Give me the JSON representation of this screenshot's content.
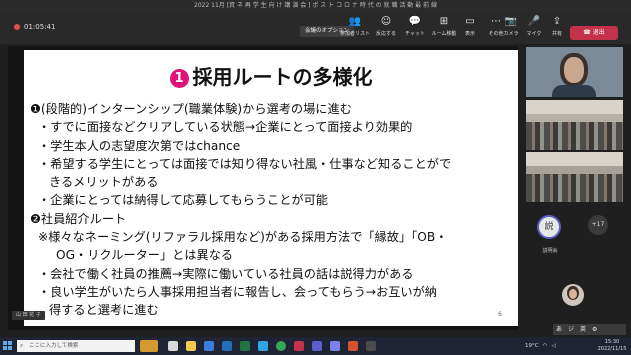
{
  "window": {
    "title": "2022 11月 [資 ネ 再 学 生 向 け 講 演 会 ] ポ ス ト コ ロ ナ 時 代 の 就 職 活 動 最 前 線"
  },
  "toolbar": {
    "timer": "01:05:41",
    "meeting_options_label": "会議のオプション",
    "buttons": [
      {
        "icon": "👥",
        "label": "参加者リスト"
      },
      {
        "icon": "☺",
        "label": "反応する"
      },
      {
        "icon": "💬",
        "label": "チャット"
      },
      {
        "icon": "⊞",
        "label": "ルーム移動"
      },
      {
        "icon": "▭",
        "label": "表示"
      },
      {
        "icon": "⋯",
        "label": "その他"
      }
    ],
    "right_buttons": [
      {
        "icon": "📷",
        "label": "カメラ"
      },
      {
        "icon": "🎤",
        "label": "マイク"
      },
      {
        "icon": "⇪",
        "label": "共有"
      }
    ],
    "leave_label": "退出"
  },
  "slide": {
    "title_number": "1",
    "title": "採用ルートの多様化",
    "lines": [
      {
        "indent": 0,
        "text": "❶(段階的)インターンシップ(職業体験)から選考の場に進む"
      },
      {
        "indent": 1,
        "text": "・すでに面接などクリアしている状態→企業にとって面接より効果的"
      },
      {
        "indent": 1,
        "text": "・学生本人の志望度次第ではchance"
      },
      {
        "indent": 1,
        "text": "・希望する学生にとっては面接では知り得ない社風・仕事など知ることがで"
      },
      {
        "indent": 2,
        "text": "きるメリットがある"
      },
      {
        "indent": 1,
        "text": "・企業にとっては納得して応募してもらうことが可能"
      },
      {
        "indent": 0,
        "text": "❷社員紹介ルート"
      },
      {
        "indent": 1,
        "text": "※様々なネーミング(リファラル採用など)がある採用方法で「縁故」「OB・"
      },
      {
        "indent": 3,
        "text": "OG・リクルーター」とは異なる"
      },
      {
        "indent": 1,
        "text": "・会社で働く社員の推薦→実際に働いている社員の話は説得力がある"
      },
      {
        "indent": 1,
        "text": "・良い学生がいたら人事採用担当者に報告し、会ってもらう→お互いが納"
      },
      {
        "indent": 2,
        "text": "得すると選考に進む"
      }
    ],
    "page_number": "6",
    "presenter": "山 田 花 子"
  },
  "participants": {
    "avatar_initials": "説",
    "avatar_name": "説明会",
    "more_count": "+17"
  },
  "ime": {
    "a": "あ",
    "ji": "ジ",
    "ime_mode": "英",
    "settings": "⚙"
  },
  "taskbar": {
    "search_placeholder": "ここに入力して検索",
    "temperature": "19°C",
    "time": "15:30",
    "date": "2022/11/15"
  }
}
